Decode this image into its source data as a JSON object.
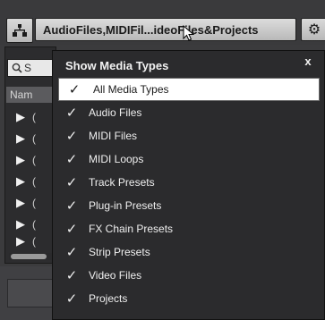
{
  "toolbar": {
    "filter_label": "AudioFiles,MIDIFil...ideoFiles&Projects",
    "sort_icon": "sort-tree-icon",
    "settings_icon": "gear-icon"
  },
  "browser": {
    "search_placeholder": "S",
    "column_header": "Nam",
    "rows": [
      "(",
      "(",
      "(",
      "(",
      "(",
      "(",
      "("
    ]
  },
  "popup": {
    "title": "Show Media Types",
    "close_label": "x",
    "check_glyph": "✓",
    "items": [
      {
        "label": "All Media Types",
        "checked": true,
        "selected": true
      },
      {
        "label": "Audio Files",
        "checked": true,
        "selected": false
      },
      {
        "label": "MIDI Files",
        "checked": true,
        "selected": false
      },
      {
        "label": "MIDI Loops",
        "checked": true,
        "selected": false
      },
      {
        "label": "Track Presets",
        "checked": true,
        "selected": false
      },
      {
        "label": "Plug-in Presets",
        "checked": true,
        "selected": false
      },
      {
        "label": "FX Chain Presets",
        "checked": true,
        "selected": false
      },
      {
        "label": "Strip Presets",
        "checked": true,
        "selected": false
      },
      {
        "label": "Video Files",
        "checked": true,
        "selected": false
      },
      {
        "label": "Projects",
        "checked": true,
        "selected": false
      }
    ]
  },
  "colors": {
    "background": "#3b3b3d",
    "popup_background": "#2b2b2d",
    "selected_row": "#ffffff",
    "button_face": "#cfcfcf"
  }
}
